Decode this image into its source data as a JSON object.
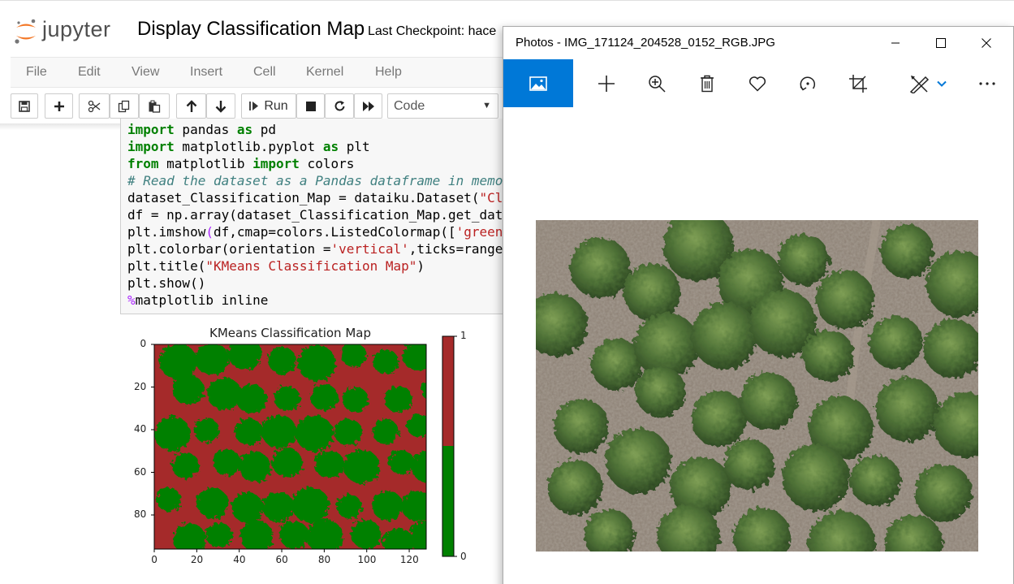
{
  "jupyter": {
    "logo_text": "jupyter",
    "notebook_title": "Display Classification Map",
    "checkpoint": "Last Checkpoint: hace",
    "menu": [
      "File",
      "Edit",
      "View",
      "Insert",
      "Cell",
      "Kernel",
      "Help"
    ],
    "toolbar": {
      "run_label": "Run",
      "cell_type": "Code",
      "icons": [
        "save-icon",
        "plus-icon",
        "scissors-icon",
        "copy-icon",
        "paste-icon",
        "arrow-up-icon",
        "arrow-down-icon",
        "run-icon",
        "stop-icon",
        "restart-icon",
        "fast-forward-icon",
        "chevron-down-icon"
      ]
    },
    "code": [
      [
        [
          "kw",
          "import"
        ],
        [
          "t",
          " pandas "
        ],
        [
          "kw",
          "as"
        ],
        [
          "t",
          " pd"
        ]
      ],
      [
        [
          "kw",
          "import"
        ],
        [
          "t",
          " matplotlib.pyplot "
        ],
        [
          "kw",
          "as"
        ],
        [
          "t",
          " plt"
        ]
      ],
      [
        [
          "kw",
          "from"
        ],
        [
          "t",
          " matplotlib "
        ],
        [
          "kw",
          "import"
        ],
        [
          "t",
          " colors"
        ]
      ],
      [
        [
          "cm",
          "# Read the dataset as a Pandas dataframe in memo"
        ]
      ],
      [
        [
          "t",
          "dataset_Classification_Map = dataiku.Dataset("
        ],
        [
          "st",
          "\"Cl"
        ]
      ],
      [
        [
          "t",
          "df = np.array(dataset_Classification_Map.get_dat"
        ]
      ],
      [
        [
          "t",
          "plt.imshow"
        ],
        [
          "mg",
          "("
        ],
        [
          "t",
          "df,cmap=colors.ListedColormap(["
        ],
        [
          "st",
          "'green"
        ]
      ],
      [
        [
          "t",
          "plt.colorbar(orientation ="
        ],
        [
          "st",
          "'vertical'"
        ],
        [
          "t",
          ",ticks=range"
        ]
      ],
      [
        [
          "t",
          "plt.title("
        ],
        [
          "st",
          "\"KMeans Classification Map\""
        ],
        [
          "t",
          ")"
        ]
      ],
      [
        [
          "t",
          "plt.show()"
        ]
      ],
      [
        [
          "mg",
          "%"
        ],
        [
          "t",
          "matplotlib inline"
        ]
      ]
    ]
  },
  "chart_data": {
    "type": "heatmap",
    "title": "KMeans Classification Map",
    "xlabel": "",
    "ylabel": "",
    "x_ticks": [
      0,
      20,
      40,
      60,
      80,
      100,
      120
    ],
    "y_ticks": [
      0,
      20,
      40,
      60,
      80
    ],
    "xlim": [
      0,
      128
    ],
    "ylim": [
      96,
      0
    ],
    "classes": [
      0,
      1
    ],
    "class_colors": [
      "#008000",
      "#a52a2a"
    ],
    "colorbar": {
      "orientation": "vertical",
      "ticks": [
        0,
        1
      ]
    }
  },
  "photos": {
    "title": "Photos - IMG_171124_204528_0152_RGB.JPG",
    "toolbar_icons": [
      "image-view-icon",
      "add-icon",
      "zoom-in-icon",
      "delete-icon",
      "heart-icon",
      "rotate-icon",
      "crop-icon",
      "edit-draw-icon",
      "chevron-down-icon",
      "more-icon"
    ],
    "window_buttons": [
      "minimize-icon",
      "maximize-icon",
      "close-icon"
    ]
  }
}
